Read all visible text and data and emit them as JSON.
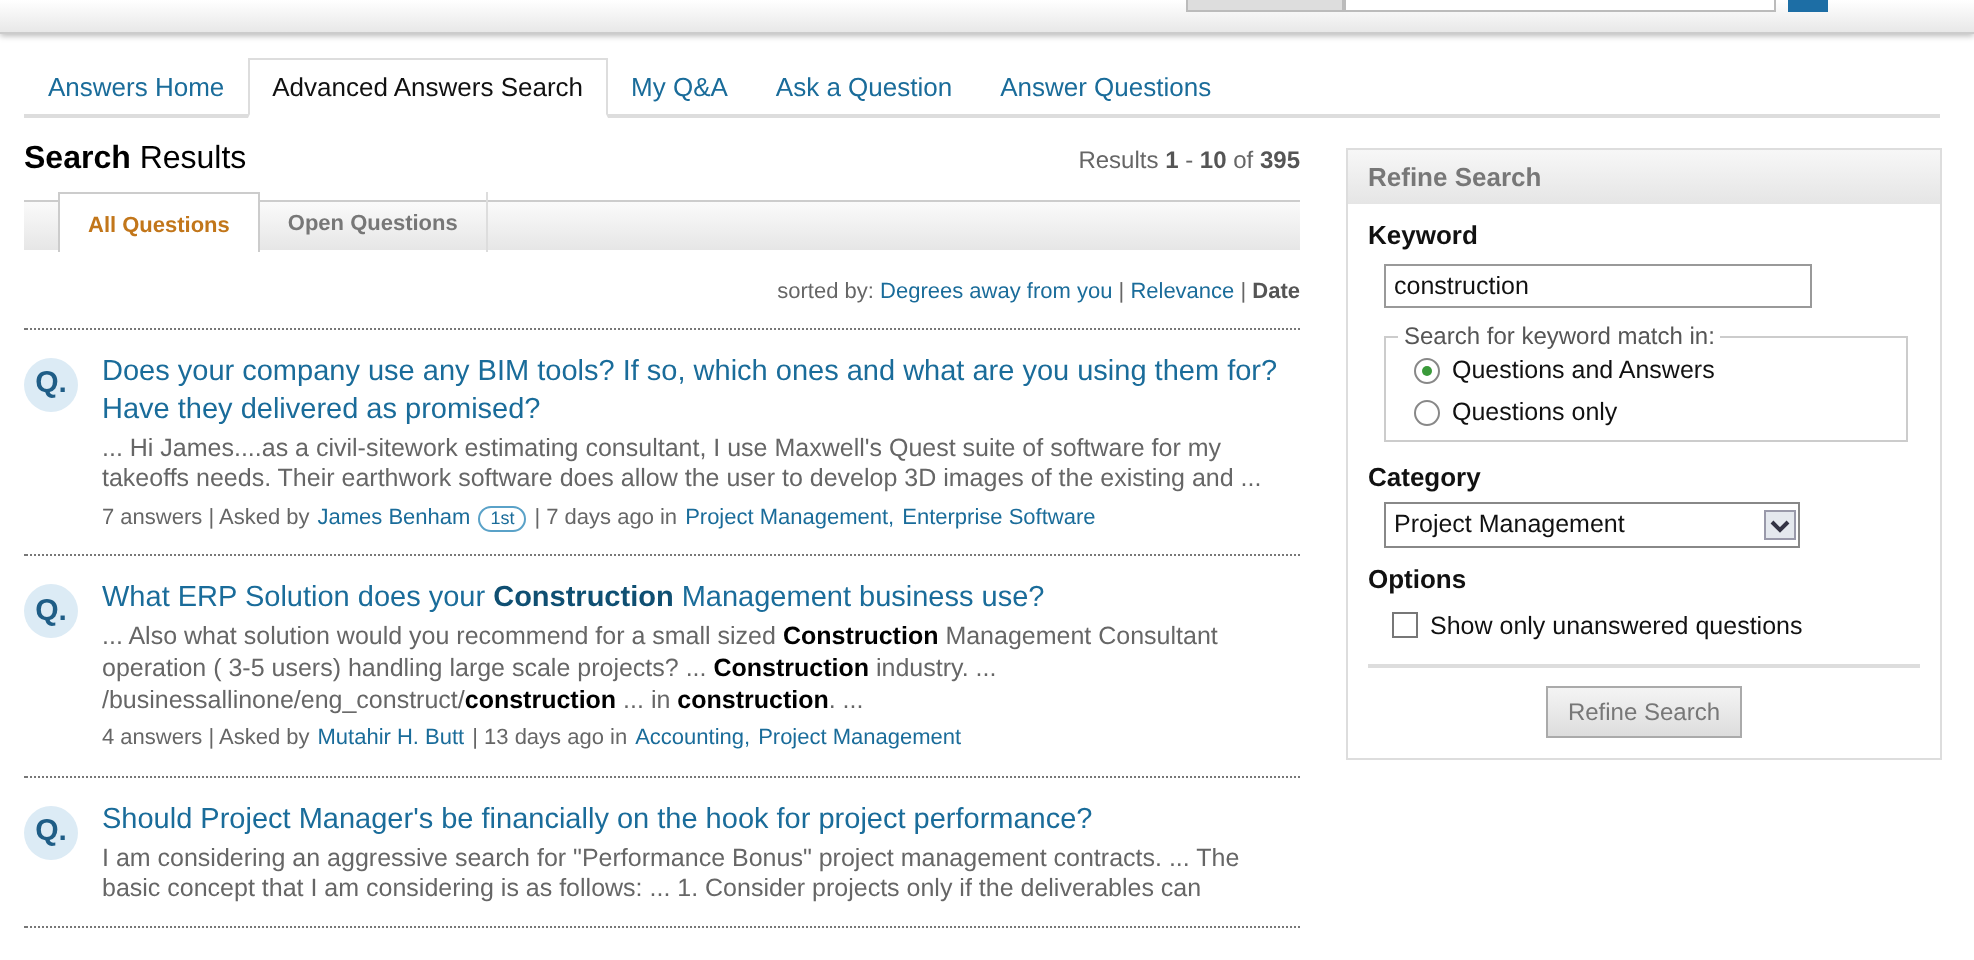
{
  "tabs": [
    {
      "label": "Answers Home",
      "selected": false
    },
    {
      "label": "Advanced Answers Search",
      "selected": true
    },
    {
      "label": "My Q&A",
      "selected": false
    },
    {
      "label": "Ask a Question",
      "selected": false
    },
    {
      "label": "Answer Questions",
      "selected": false
    }
  ],
  "results": {
    "title": "**Search** Results",
    "count": "Results **1** - **10** of **395**",
    "subtabs": [
      {
        "label": "All Questions",
        "selected": true
      },
      {
        "label": "Open Questions",
        "selected": false
      }
    ],
    "sort": {
      "label": "sorted by:",
      "separator": "|",
      "options": [
        {
          "label": "Degrees away from you",
          "selected": false
        },
        {
          "label": "Relevance",
          "selected": false
        },
        {
          "label": "Date",
          "selected": true
        }
      ]
    },
    "questions": [
      {
        "marker": "Q.",
        "title": "Does your company use any BIM tools? If so, which ones and what are you using them for? Have they delivered as promised?",
        "snippet": "... Hi James....as a civil-sitework estimating consultant, I use Maxwell's Quest suite of software for my takeoffs needs. Their earthwork software does allow the user to develop 3D images of the existing and ...",
        "meta": [
          {
            "kind": "text",
            "text": "7 answers | Asked by"
          },
          {
            "kind": "link",
            "text": "James Benham"
          },
          {
            "kind": "badge",
            "text": "1st"
          },
          {
            "kind": "text",
            "text": "| 7 days ago in"
          },
          {
            "kind": "link",
            "text": "Project Management,"
          },
          {
            "kind": "link",
            "text": "Enterprise Software"
          }
        ]
      },
      {
        "marker": "Q.",
        "title": "What ERP Solution does your **Construction** Management business use?",
        "snippet": "... Also what solution would you recommend for a small sized **Construction** Management Consultant operation ( 3-5 users) handling large scale projects? ... **Construction** industry. ... /businessallinone/eng_construct/**construction** ... in **construction**. ...",
        "meta": [
          {
            "kind": "text",
            "text": "4 answers | Asked by"
          },
          {
            "kind": "link",
            "text": "Mutahir H. Butt"
          },
          {
            "kind": "text",
            "text": "| 13 days ago in"
          },
          {
            "kind": "link",
            "text": "Accounting,"
          },
          {
            "kind": "link",
            "text": "Project Management"
          }
        ]
      },
      {
        "marker": "Q.",
        "title": "Should Project Manager's be financially on the hook for project performance?",
        "snippet": "I am considering an aggressive search for \"Performance Bonus\" project management contracts. ... The basic concept that I am considering is as follows: ... 1. Consider projects only if the deliverables can"
      }
    ]
  },
  "refine": {
    "title": "Refine Search",
    "keyword_label": "Keyword",
    "keyword": "construction",
    "match_legend": "Search for keyword match in:",
    "match_options": [
      {
        "label": "Questions and Answers",
        "selected": true
      },
      {
        "label": "Questions only",
        "selected": false
      }
    ],
    "category_label": "Category",
    "category": "Project Management",
    "options_label": "Options",
    "unanswered": {
      "label": "Show only unanswered questions",
      "checked": false
    },
    "button": "Refine Search"
  }
}
